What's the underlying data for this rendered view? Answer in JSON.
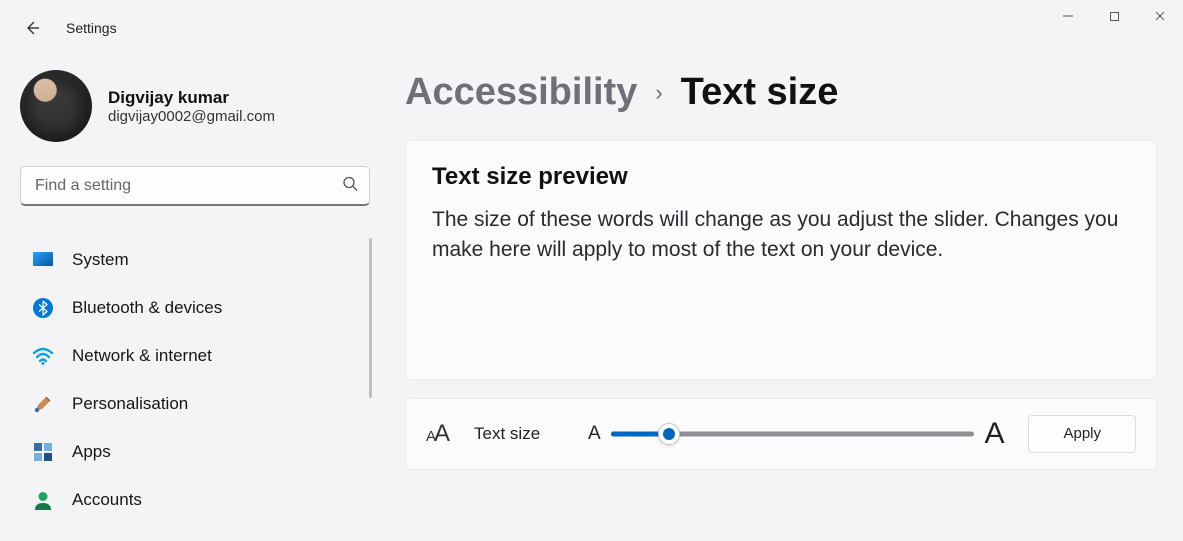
{
  "window": {
    "app_title": "Settings"
  },
  "profile": {
    "name": "Digvijay kumar",
    "email": "digvijay0002@gmail.com"
  },
  "search": {
    "placeholder": "Find a setting"
  },
  "nav": {
    "items": [
      {
        "label": "System",
        "icon": "system-icon",
        "color": "#0078d4"
      },
      {
        "label": "Bluetooth & devices",
        "icon": "bluetooth-icon",
        "color": "#0078d4"
      },
      {
        "label": "Network & internet",
        "icon": "wifi-icon",
        "color": "#0aa1dd"
      },
      {
        "label": "Personalisation",
        "icon": "paintbrush-icon",
        "color": "#b06a3e"
      },
      {
        "label": "Apps",
        "icon": "apps-icon",
        "color": "#3a6cae"
      },
      {
        "label": "Accounts",
        "icon": "accounts-icon",
        "color": "#1fa463"
      }
    ]
  },
  "breadcrumb": {
    "parent": "Accessibility",
    "current": "Text size"
  },
  "preview": {
    "title": "Text size preview",
    "body": "The size of these words will change as you adjust the slider. Changes you make here will apply to most of the text on your device."
  },
  "slider": {
    "label": "Text size",
    "min_glyph": "A",
    "max_glyph": "A",
    "value_percent": 16,
    "apply_label": "Apply"
  }
}
